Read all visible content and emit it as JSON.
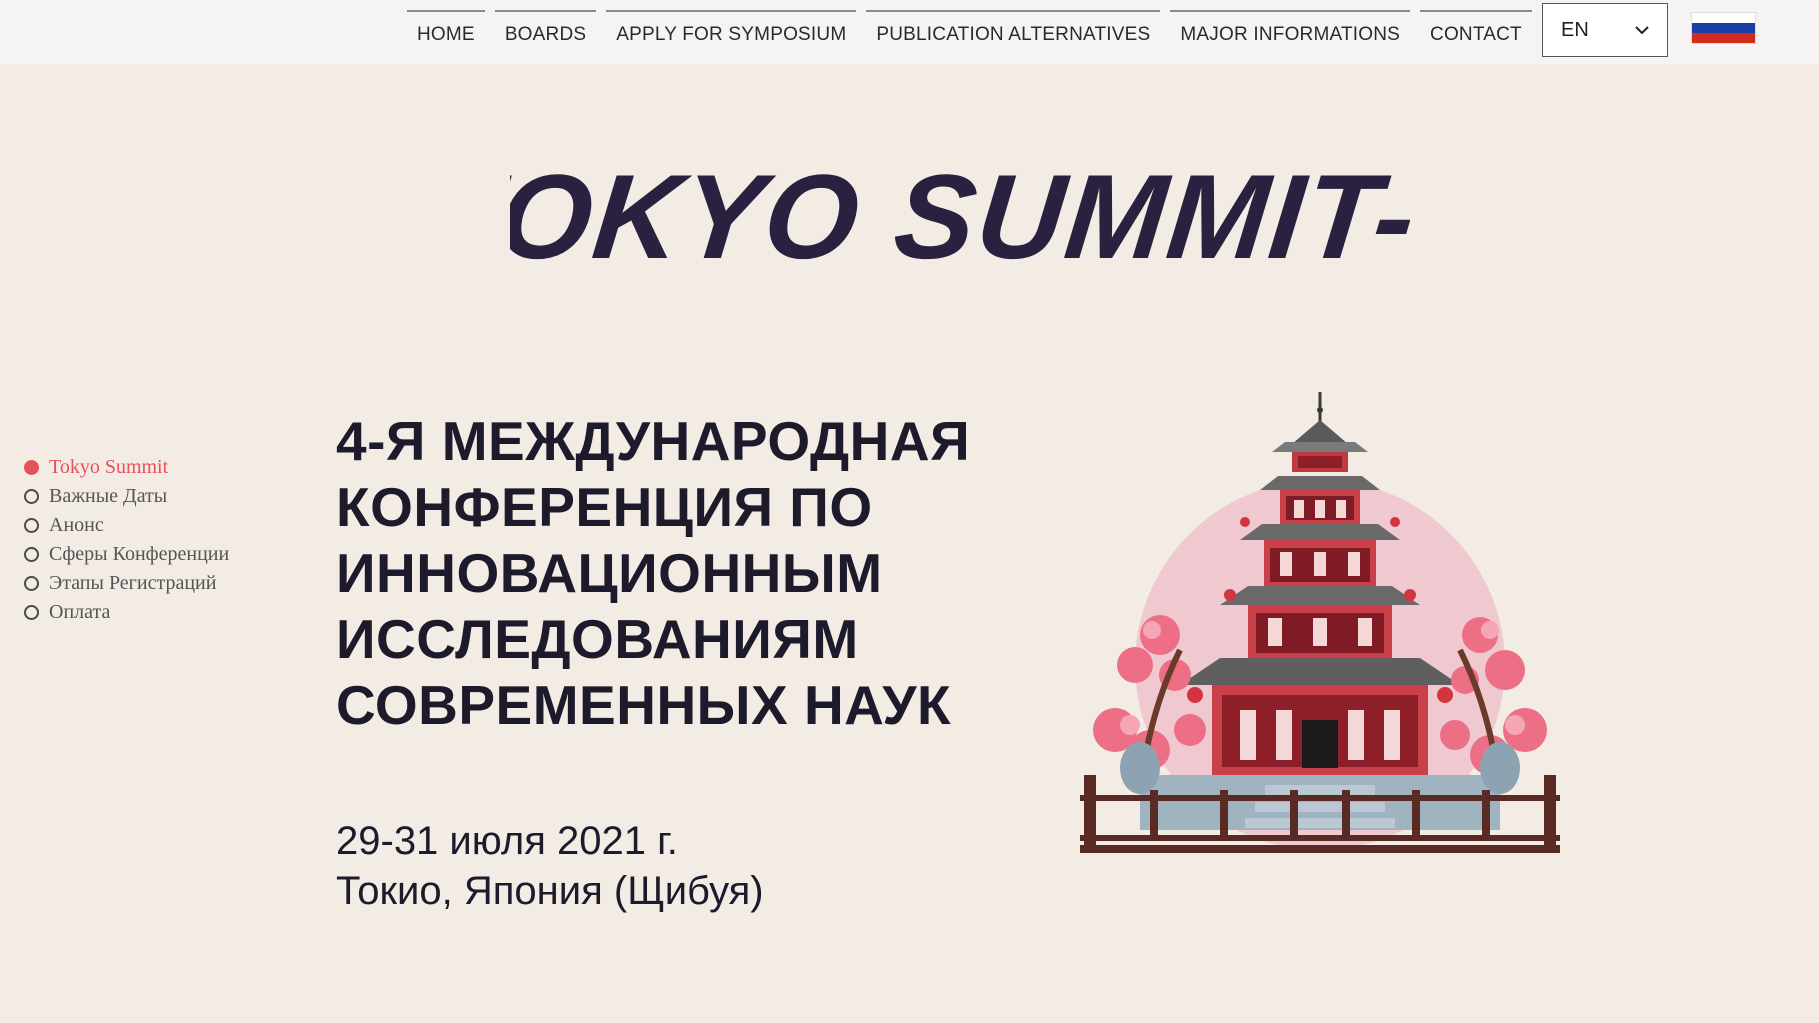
{
  "nav": {
    "items": [
      {
        "label": "HOME"
      },
      {
        "label": "BOARDS"
      },
      {
        "label": "APPLY FOR SYMPOSIUM"
      },
      {
        "label": "PUBLICATION ALTERNATIVES"
      },
      {
        "label": "MAJOR INFORMATIONS"
      },
      {
        "label": "CONTACT"
      }
    ]
  },
  "language": {
    "selected": "EN",
    "flag_colors": [
      "#ffffff",
      "#1a3fa6",
      "#d52b1e"
    ]
  },
  "brand": {
    "title": "TOKYO SUMMIT-V"
  },
  "sidenav": {
    "items": [
      {
        "label": "Tokyo Summit",
        "active": true
      },
      {
        "label": "Важные Даты",
        "active": false
      },
      {
        "label": "Анонс",
        "active": false
      },
      {
        "label": "Сферы Конференции",
        "active": false
      },
      {
        "label": "Этапы Регистраций",
        "active": false
      },
      {
        "label": "Оплата",
        "active": false
      }
    ]
  },
  "hero": {
    "headline_lines": [
      "4-Я МЕЖДУНАРОДНАЯ",
      "КОНФЕРЕНЦИЯ ПО",
      "ИННОВАЦИОННЫМ",
      "ИССЛЕДОВАНИЯМ",
      "СОВРЕМЕННЫХ НАУК"
    ],
    "date": "29-31 июля 2021 г.",
    "location": "Токио, Япония (Щибуя)"
  },
  "colors": {
    "background": "#f3ece5",
    "accent": "#e8505b",
    "text_dark": "#1d1a2c"
  }
}
